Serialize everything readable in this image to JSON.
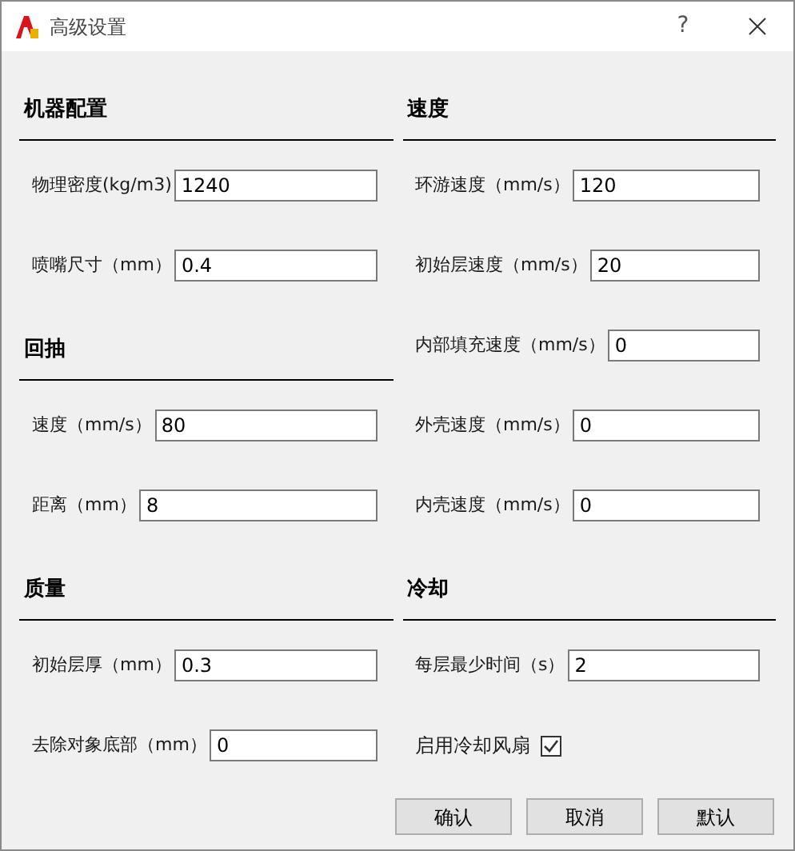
{
  "window": {
    "title": "高级设置",
    "help": "?"
  },
  "columns": [
    {
      "items": [
        {
          "kind": "heading",
          "label": "机器配置"
        },
        {
          "kind": "field",
          "label": "物理密度(kg/m3)",
          "value": "1240"
        },
        {
          "kind": "field",
          "label": "喷嘴尺寸（mm）",
          "value": "0.4"
        },
        {
          "kind": "heading",
          "label": "回抽"
        },
        {
          "kind": "field",
          "label": "速度（mm/s）",
          "value": "80"
        },
        {
          "kind": "field",
          "label": "距离（mm）",
          "value": "8"
        },
        {
          "kind": "heading",
          "label": "质量"
        },
        {
          "kind": "field",
          "label": "初始层厚（mm）",
          "value": "0.3"
        },
        {
          "kind": "field",
          "label": "去除对象底部（mm）",
          "value": "0"
        }
      ]
    },
    {
      "items": [
        {
          "kind": "heading",
          "label": "速度"
        },
        {
          "kind": "field",
          "label": "环游速度（mm/s）",
          "value": "120"
        },
        {
          "kind": "field",
          "label": "初始层速度（mm/s）",
          "value": "20"
        },
        {
          "kind": "field",
          "label": "内部填充速度（mm/s）",
          "value": "0"
        },
        {
          "kind": "field",
          "label": "外壳速度（mm/s）",
          "value": "0"
        },
        {
          "kind": "field",
          "label": "内壳速度（mm/s）",
          "value": "0"
        },
        {
          "kind": "heading",
          "label": "冷却"
        },
        {
          "kind": "field",
          "label": "每层最少时间（s）",
          "value": "2"
        },
        {
          "kind": "checkbox",
          "label": "启用冷却风扇",
          "checked": true
        }
      ]
    }
  ],
  "buttons": [
    "确认",
    "取消",
    "默认"
  ]
}
